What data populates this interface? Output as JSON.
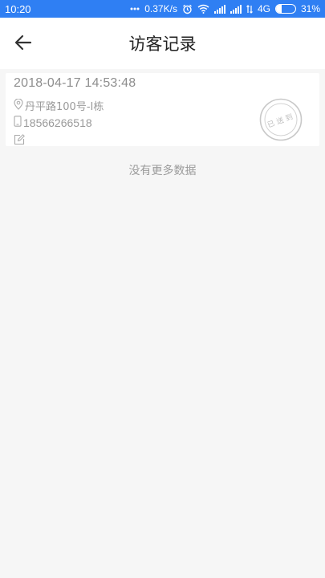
{
  "status_bar": {
    "time": "10:20",
    "network_speed": "0.37K/s",
    "network_type": "4G",
    "battery_percent": "31%",
    "battery_level": 0.31,
    "icons": [
      "dots-icon",
      "alarm-icon",
      "wifi-icon",
      "signal-icon",
      "signal-icon",
      "data-transfer-icon",
      "battery-icon"
    ]
  },
  "header": {
    "title": "访客记录",
    "back_icon": "back-arrow-icon"
  },
  "records": [
    {
      "time": "2018-04-17 14:53:48",
      "address": "丹平路100号-I栋",
      "phone": "18566266518",
      "stamp_text": "已送到"
    }
  ],
  "footer_text": "没有更多数据",
  "colors": {
    "status_bar": "#2f7ff3",
    "background": "#f6f6f6",
    "card": "#ffffff",
    "muted_text": "#9a9a9a"
  }
}
